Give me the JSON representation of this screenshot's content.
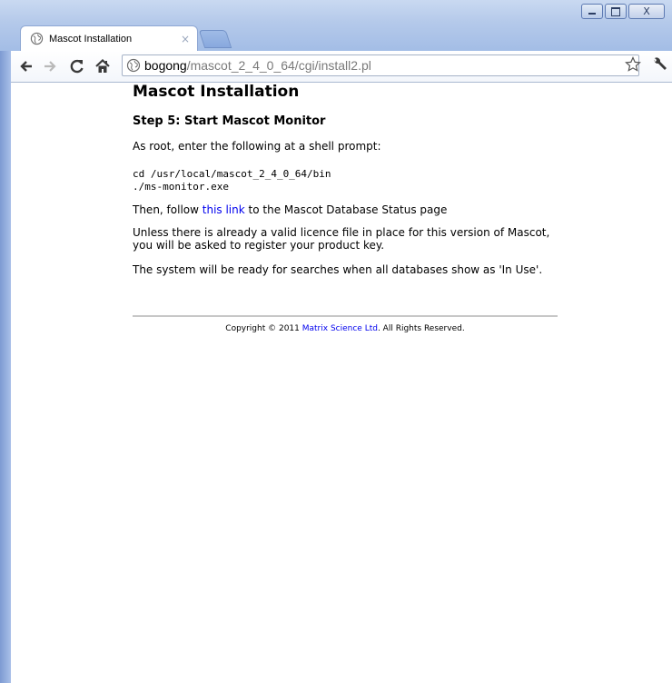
{
  "browser": {
    "tab": {
      "title": "Mascot Installation",
      "close_label": "×"
    },
    "url": {
      "host": "bogong",
      "path": "/mascot_2_4_0_64/cgi/install2.pl"
    },
    "window_controls": {
      "close_label": "X"
    },
    "icons": [
      "globe-icon",
      "back-arrow-icon",
      "forward-arrow-icon",
      "reload-icon",
      "home-icon",
      "star-icon",
      "wrench-icon"
    ]
  },
  "page": {
    "title": "Mascot Installation",
    "step_heading": "Step 5: Start Mascot Monitor",
    "intro": "As root, enter the following at a shell prompt:",
    "commands": [
      "cd /usr/local/mascot_2_4_0_64/bin",
      "./ms-monitor.exe"
    ],
    "follow_prefix": "Then, follow ",
    "follow_link": "this link",
    "follow_suffix": " to the Mascot Database Status page",
    "licence_note": "Unless there is already a valid licence file in place for this version of Mascot, you will be asked to register your product key.",
    "ready_note": "The system will be ready for searches when all databases show as 'In Use'.",
    "footer": {
      "prefix": "Copyright © 2011 ",
      "company_link": "Matrix Science Ltd",
      "suffix": ".  All Rights Reserved."
    }
  },
  "colors": {
    "link": "#0000ee",
    "chrome_blue": "#b4c9ea"
  }
}
